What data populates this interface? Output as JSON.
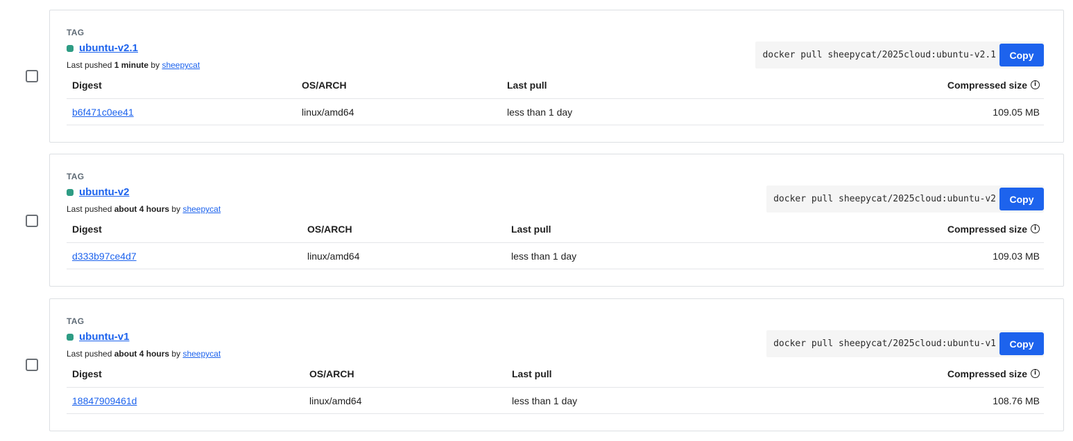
{
  "tag_caption": "TAG",
  "columns": {
    "digest": "Digest",
    "os_arch": "OS/ARCH",
    "last_pull": "Last pull",
    "compressed_size": "Compressed size"
  },
  "pushed_prefix": "Last pushed",
  "by_text": "by",
  "copy_label": "Copy",
  "colors": {
    "accent": "#1d63ed",
    "status_dot": "#2e9c84"
  },
  "icons": {
    "status": "status-dot-icon",
    "info": "info-circle-icon"
  },
  "tags": [
    {
      "name": "ubuntu-v2.1",
      "pushed_when": "1 minute",
      "pushed_by": "sheepycat",
      "pull_command": "docker pull sheepycat/2025cloud:ubuntu-v2.1",
      "digest": "b6f471c0ee41",
      "os_arch": "linux/amd64",
      "last_pull": "less than 1 day",
      "size": "109.05 MB"
    },
    {
      "name": "ubuntu-v2",
      "pushed_when": "about 4 hours",
      "pushed_by": "sheepycat",
      "pull_command": "docker pull sheepycat/2025cloud:ubuntu-v2",
      "digest": "d333b97ce4d7",
      "os_arch": "linux/amd64",
      "last_pull": "less than 1 day",
      "size": "109.03 MB"
    },
    {
      "name": "ubuntu-v1",
      "pushed_when": "about 4 hours",
      "pushed_by": "sheepycat",
      "pull_command": "docker pull sheepycat/2025cloud:ubuntu-v1",
      "digest": "18847909461d",
      "os_arch": "linux/amd64",
      "last_pull": "less than 1 day",
      "size": "108.76 MB"
    }
  ]
}
